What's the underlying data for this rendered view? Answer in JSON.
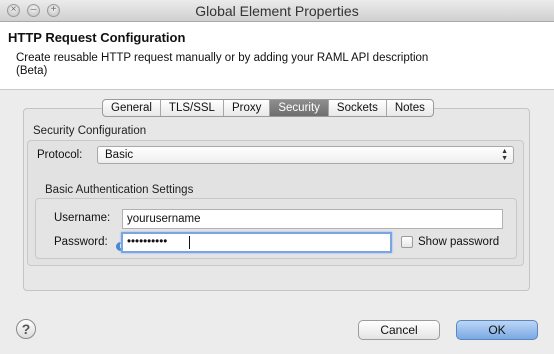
{
  "window": {
    "title": "Global Element Properties",
    "close_glyph": "×",
    "minimize_glyph": "–",
    "maximize_glyph": "+"
  },
  "header": {
    "title": "HTTP Request Configuration",
    "description": "Create reusable HTTP request manually or by adding your RAML API description (Beta)"
  },
  "tabs": [
    {
      "label": "General",
      "active": false
    },
    {
      "label": "TLS/SSL",
      "active": false
    },
    {
      "label": "Proxy",
      "active": false
    },
    {
      "label": "Security",
      "active": true
    },
    {
      "label": "Sockets",
      "active": false
    },
    {
      "label": "Notes",
      "active": false
    }
  ],
  "security": {
    "section_title": "Security Configuration",
    "protocol_label": "Protocol:",
    "protocol_value": "Basic",
    "protocol_arrows": "▲▼",
    "basic_auth_title": "Basic Authentication Settings",
    "username_label": "Username:",
    "username_value": "yourusername",
    "password_label": "Password:",
    "password_value": "••••••••••",
    "info_glyph": "i",
    "show_password_label": "Show password",
    "show_password_checked": false
  },
  "footer": {
    "help_glyph": "?",
    "cancel_label": "Cancel",
    "ok_label": "OK"
  },
  "colors": {
    "active_tab": "#7a7a7a",
    "focus_ring": "#79a5e1",
    "ok_button": "#8fb7ea",
    "info_icon": "#4a86d6"
  }
}
